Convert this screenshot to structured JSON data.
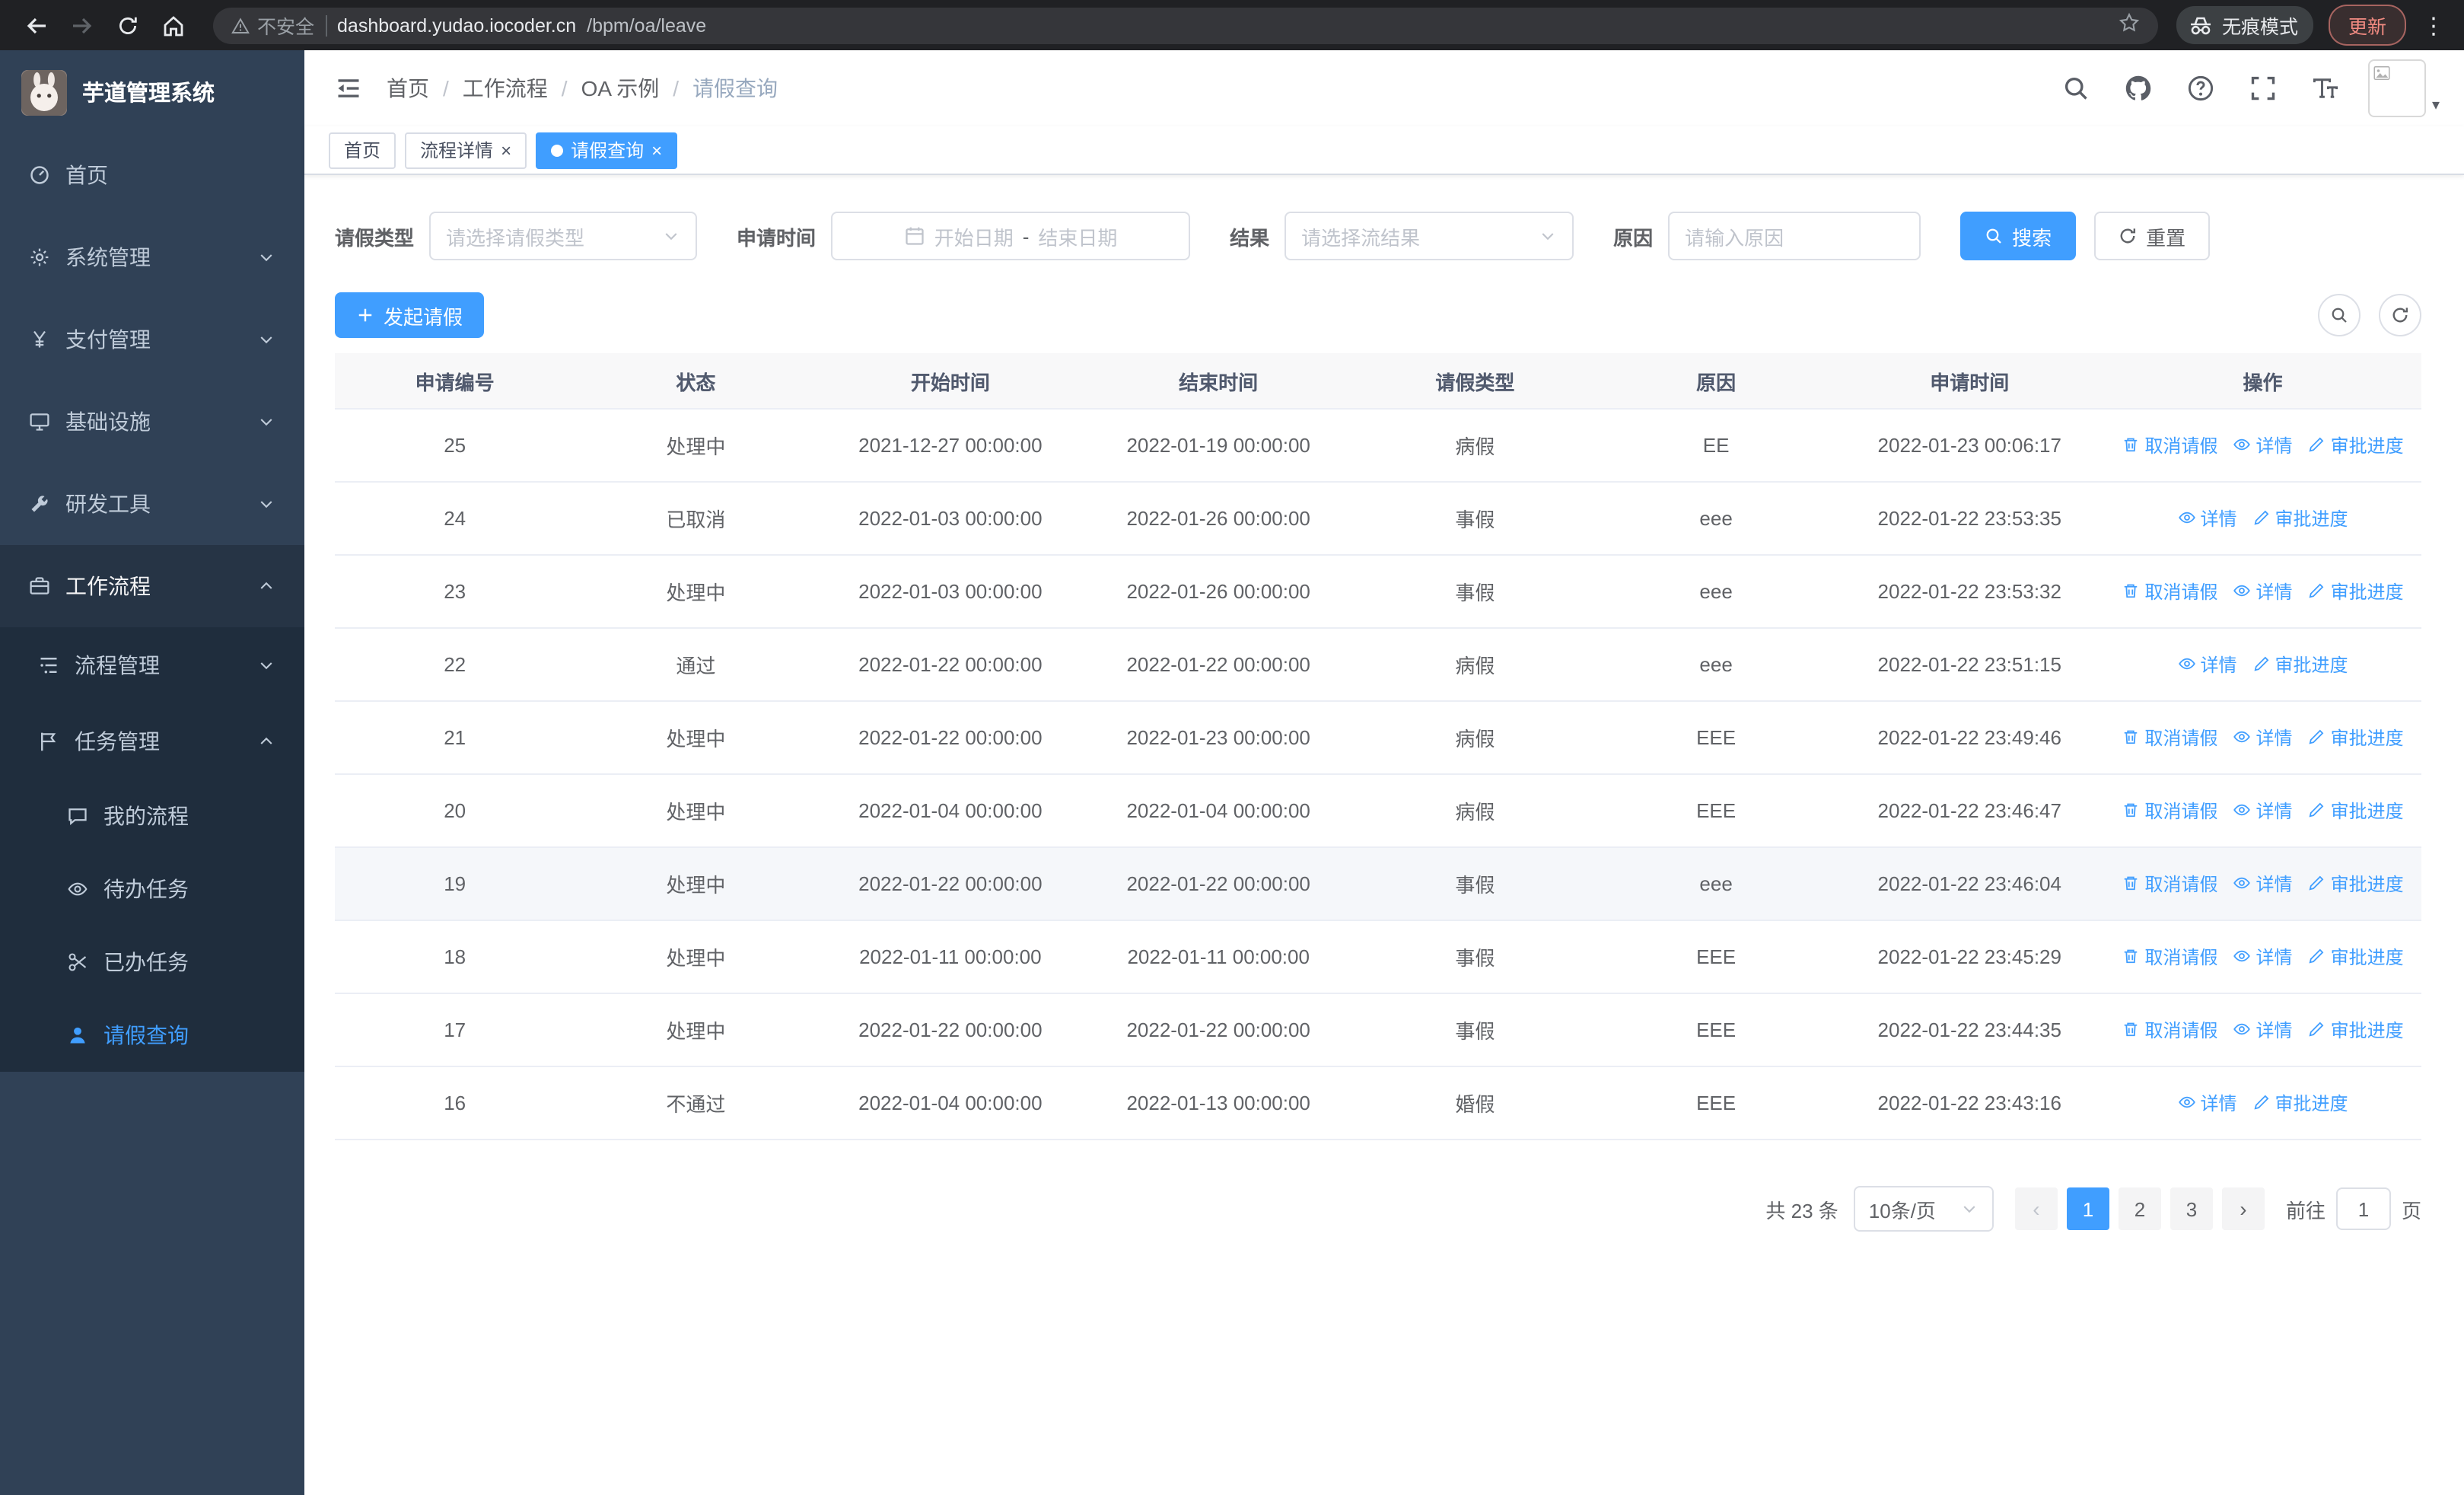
{
  "browser": {
    "warning": "不安全",
    "url_domain": "dashboard.yudao.iocoder.cn",
    "url_path": "/bpm/oa/leave",
    "incognito": "无痕模式",
    "update": "更新"
  },
  "icons": {
    "close": "×",
    "more_vertical": "⋮",
    "chev_left": "‹",
    "chev_right": "›",
    "caret_down": "▾"
  },
  "sidebar": {
    "title": "芋道管理系统",
    "items": [
      {
        "label": "首页"
      },
      {
        "label": "系统管理"
      },
      {
        "label": "支付管理"
      },
      {
        "label": "基础设施"
      },
      {
        "label": "研发工具"
      },
      {
        "label": "工作流程"
      }
    ],
    "process_mgmt": "流程管理",
    "task_mgmt": "任务管理",
    "task_children": [
      {
        "label": "我的流程"
      },
      {
        "label": "待办任务"
      },
      {
        "label": "已办任务"
      },
      {
        "label": "请假查询"
      }
    ]
  },
  "breadcrumb": {
    "items": [
      "首页",
      "工作流程",
      "OA 示例",
      "请假查询"
    ],
    "separator": "/"
  },
  "tabs": [
    {
      "label": "首页"
    },
    {
      "label": "流程详情"
    },
    {
      "label": "请假查询"
    }
  ],
  "filters": {
    "type_label": "请假类型",
    "type_placeholder": "请选择请假类型",
    "time_label": "申请时间",
    "start_placeholder": "开始日期",
    "range_separator": "-",
    "end_placeholder": "结束日期",
    "result_label": "结果",
    "result_placeholder": "请选择流结果",
    "reason_label": "原因",
    "reason_placeholder": "请输入原因",
    "search": "搜索",
    "reset": "重置"
  },
  "toolbar": {
    "create": "发起请假"
  },
  "table": {
    "headers": [
      "申请编号",
      "状态",
      "开始时间",
      "结束时间",
      "请假类型",
      "原因",
      "申请时间",
      "操作"
    ],
    "action_labels": {
      "cancel": "取消请假",
      "detail": "详情",
      "progress": "审批进度"
    },
    "rows": [
      {
        "no": "25",
        "status": "处理中",
        "start": "2021-12-27 00:00:00",
        "end": "2022-01-19 00:00:00",
        "type": "病假",
        "reason": "EE",
        "applied": "2022-01-23 00:06:17",
        "actions": [
          "cancel",
          "detail",
          "progress"
        ],
        "highlight": false
      },
      {
        "no": "24",
        "status": "已取消",
        "start": "2022-01-03 00:00:00",
        "end": "2022-01-26 00:00:00",
        "type": "事假",
        "reason": "eee",
        "applied": "2022-01-22 23:53:35",
        "actions": [
          "detail",
          "progress"
        ],
        "highlight": false
      },
      {
        "no": "23",
        "status": "处理中",
        "start": "2022-01-03 00:00:00",
        "end": "2022-01-26 00:00:00",
        "type": "事假",
        "reason": "eee",
        "applied": "2022-01-22 23:53:32",
        "actions": [
          "cancel",
          "detail",
          "progress"
        ],
        "highlight": false
      },
      {
        "no": "22",
        "status": "通过",
        "start": "2022-01-22 00:00:00",
        "end": "2022-01-22 00:00:00",
        "type": "病假",
        "reason": "eee",
        "applied": "2022-01-22 23:51:15",
        "actions": [
          "detail",
          "progress"
        ],
        "highlight": false
      },
      {
        "no": "21",
        "status": "处理中",
        "start": "2022-01-22 00:00:00",
        "end": "2022-01-23 00:00:00",
        "type": "病假",
        "reason": "EEE",
        "applied": "2022-01-22 23:49:46",
        "actions": [
          "cancel",
          "detail",
          "progress"
        ],
        "highlight": false
      },
      {
        "no": "20",
        "status": "处理中",
        "start": "2022-01-04 00:00:00",
        "end": "2022-01-04 00:00:00",
        "type": "病假",
        "reason": "EEE",
        "applied": "2022-01-22 23:46:47",
        "actions": [
          "cancel",
          "detail",
          "progress"
        ],
        "highlight": false
      },
      {
        "no": "19",
        "status": "处理中",
        "start": "2022-01-22 00:00:00",
        "end": "2022-01-22 00:00:00",
        "type": "事假",
        "reason": "eee",
        "applied": "2022-01-22 23:46:04",
        "actions": [
          "cancel",
          "detail",
          "progress"
        ],
        "highlight": true
      },
      {
        "no": "18",
        "status": "处理中",
        "start": "2022-01-11 00:00:00",
        "end": "2022-01-11 00:00:00",
        "type": "事假",
        "reason": "EEE",
        "applied": "2022-01-22 23:45:29",
        "actions": [
          "cancel",
          "detail",
          "progress"
        ],
        "highlight": false
      },
      {
        "no": "17",
        "status": "处理中",
        "start": "2022-01-22 00:00:00",
        "end": "2022-01-22 00:00:00",
        "type": "事假",
        "reason": "EEE",
        "applied": "2022-01-22 23:44:35",
        "actions": [
          "cancel",
          "detail",
          "progress"
        ],
        "highlight": false
      },
      {
        "no": "16",
        "status": "不通过",
        "start": "2022-01-04 00:00:00",
        "end": "2022-01-13 00:00:00",
        "type": "婚假",
        "reason": "EEE",
        "applied": "2022-01-22 23:43:16",
        "actions": [
          "detail",
          "progress"
        ],
        "highlight": false
      }
    ]
  },
  "pagination": {
    "total": "共 23 条",
    "page_size": "10条/页",
    "pages": [
      "1",
      "2",
      "3"
    ],
    "active_page": "1",
    "goto_label": "前往",
    "goto_value": "1",
    "page_unit": "页"
  },
  "colors": {
    "accent": "#409eff",
    "sidebar_bg": "#304156",
    "submenu_bg": "#1f2d3d"
  }
}
